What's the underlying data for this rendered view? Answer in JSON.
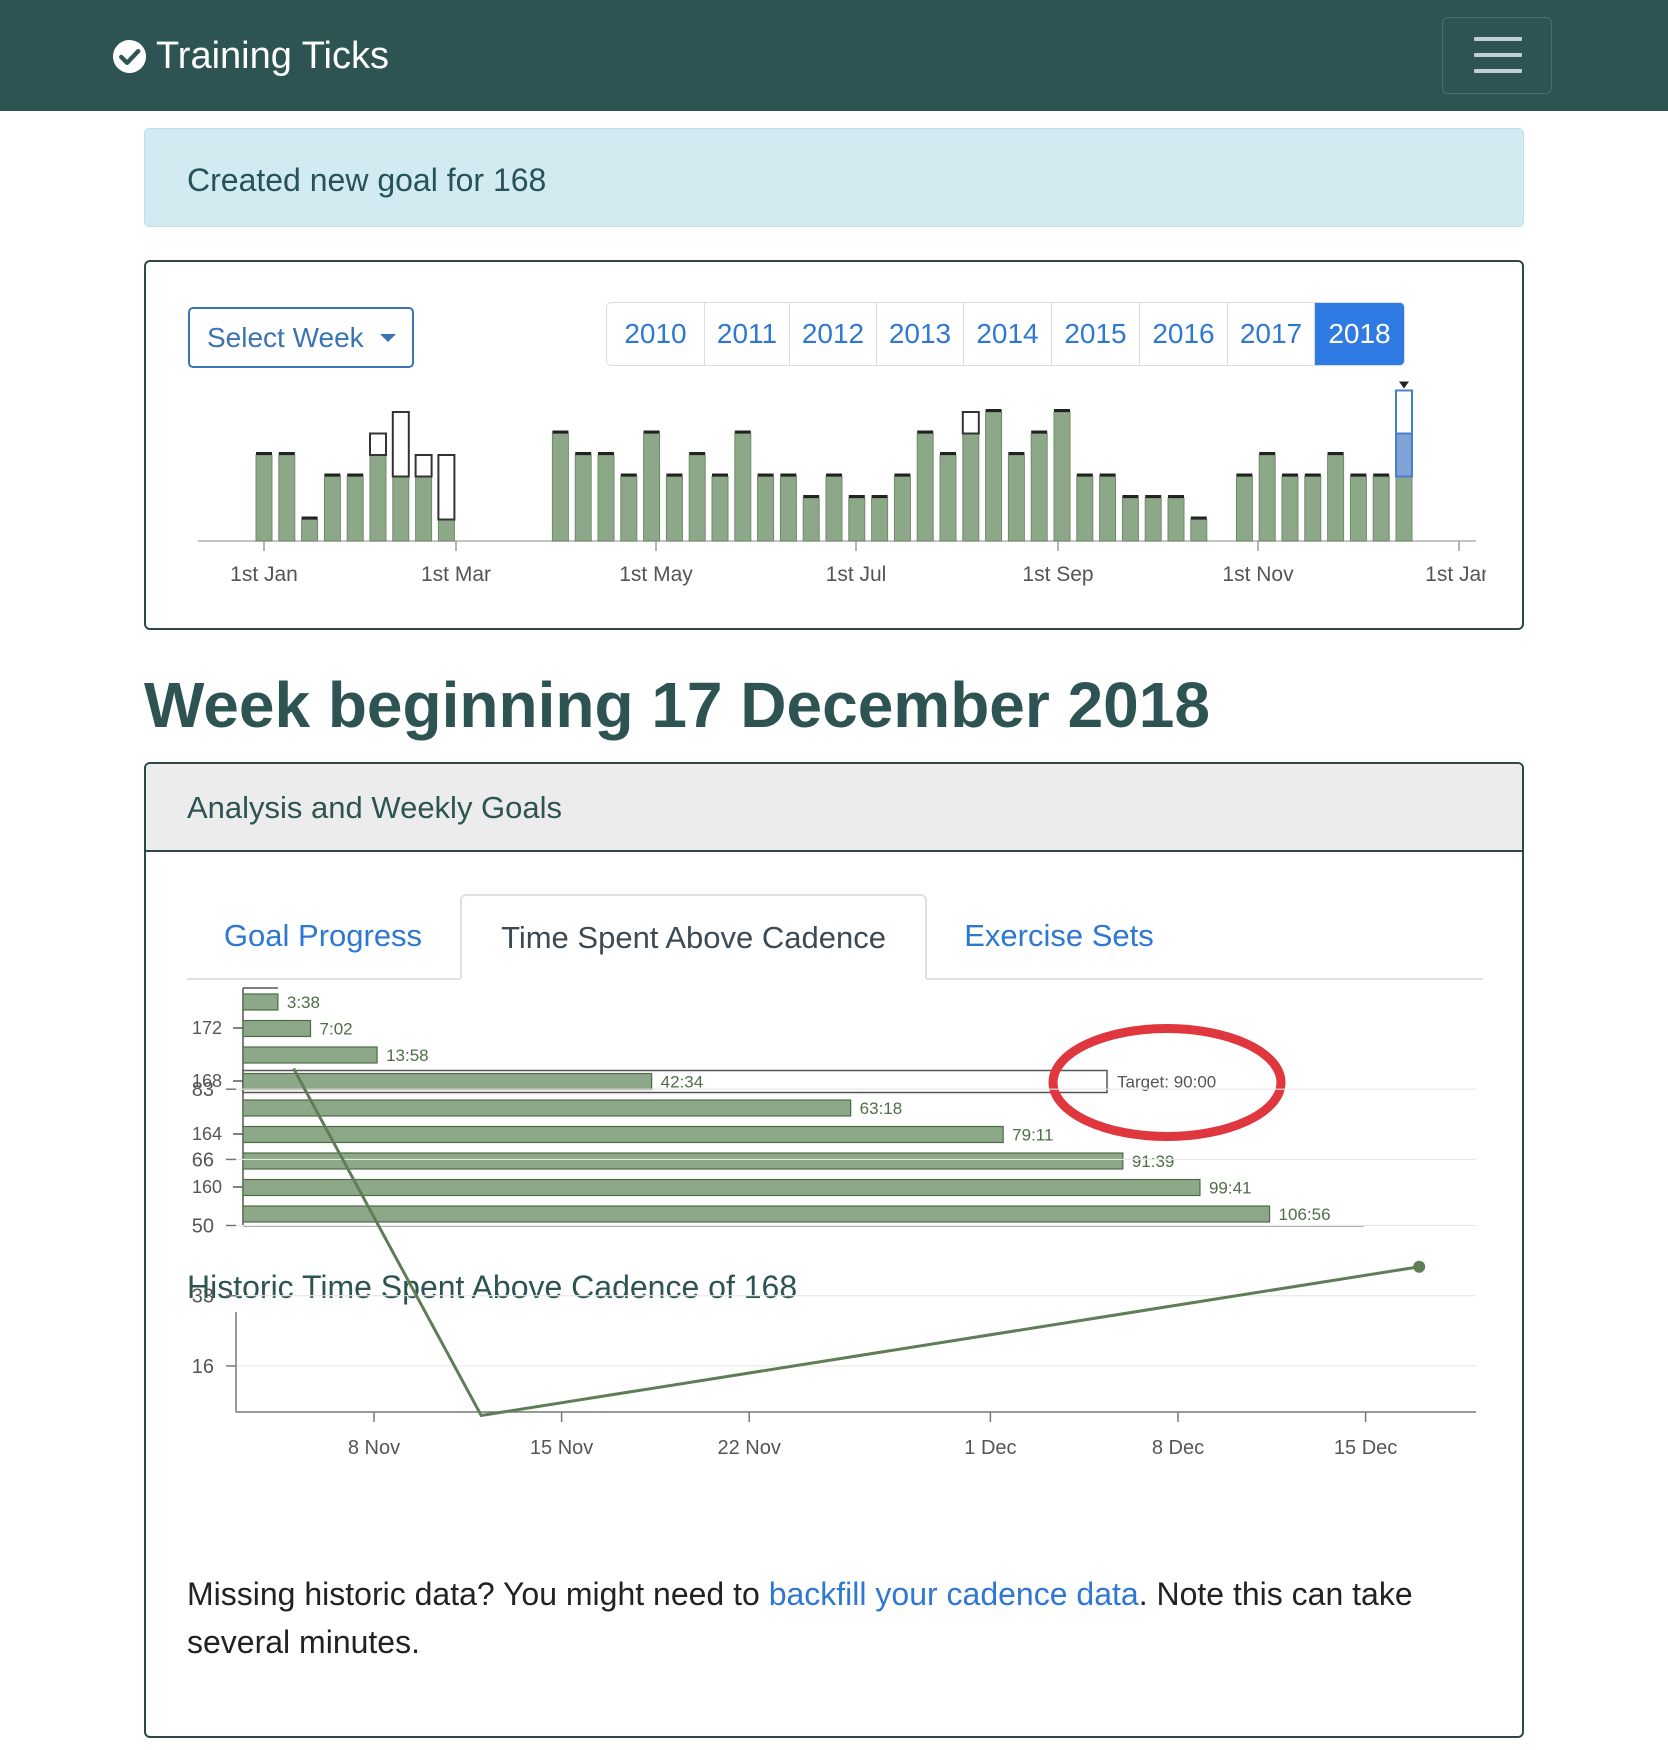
{
  "navbar": {
    "brand": "Training Ticks",
    "brand_icon": "check-circle-icon",
    "menu_icon": "hamburger-menu-icon"
  },
  "alert": {
    "text": "Created new goal for 168"
  },
  "week_selector": {
    "select_label": "Select Week",
    "years": [
      "2010",
      "2011",
      "2012",
      "2013",
      "2014",
      "2015",
      "2016",
      "2017",
      "2018"
    ],
    "active_year": "2018"
  },
  "page": {
    "title": "Week beginning 17 December 2018"
  },
  "analysis": {
    "header": "Analysis and Weekly Goals",
    "tabs": [
      {
        "label": "Goal Progress",
        "active": false
      },
      {
        "label": "Time Spent Above Cadence",
        "active": true
      },
      {
        "label": "Exercise Sets",
        "active": false
      }
    ],
    "historic_title": "Historic Time Spent Above Cadence of 168",
    "footnote": {
      "before": "Missing historic data? You might need to ",
      "link": "backfill your cadence data",
      "after": ". Note this can take several minutes."
    }
  },
  "colors": {
    "bar_green": "#8da888",
    "line_green": "#5f7d56",
    "nav_bg": "#2d5452",
    "accent_blue": "#2f7be3",
    "annotation_red": "#e0363e"
  },
  "chart_data": [
    {
      "type": "bar",
      "title": "",
      "x_tick_labels": [
        "1st Jan",
        "1st Mar",
        "1st May",
        "1st Jul",
        "1st Sep",
        "1st Nov",
        "1st Jan"
      ],
      "weeks": [
        {
          "week": 1,
          "done": 4,
          "goal_extra": 0
        },
        {
          "week": 2,
          "done": 4,
          "goal_extra": 0
        },
        {
          "week": 3,
          "done": 1,
          "goal_extra": 0
        },
        {
          "week": 4,
          "done": 3,
          "goal_extra": 0
        },
        {
          "week": 5,
          "done": 3,
          "goal_extra": 0
        },
        {
          "week": 6,
          "done": 4,
          "goal_extra": 1
        },
        {
          "week": 7,
          "done": 3,
          "goal_extra": 3
        },
        {
          "week": 8,
          "done": 3,
          "goal_extra": 1
        },
        {
          "week": 9,
          "done": 1,
          "goal_extra": 3
        },
        {
          "week": 14,
          "done": 5,
          "goal_extra": 0
        },
        {
          "week": 15,
          "done": 4,
          "goal_extra": 0
        },
        {
          "week": 16,
          "done": 4,
          "goal_extra": 0
        },
        {
          "week": 17,
          "done": 3,
          "goal_extra": 0
        },
        {
          "week": 18,
          "done": 5,
          "goal_extra": 0
        },
        {
          "week": 19,
          "done": 3,
          "goal_extra": 0
        },
        {
          "week": 20,
          "done": 4,
          "goal_extra": 0
        },
        {
          "week": 21,
          "done": 3,
          "goal_extra": 0
        },
        {
          "week": 22,
          "done": 5,
          "goal_extra": 0
        },
        {
          "week": 23,
          "done": 3,
          "goal_extra": 0
        },
        {
          "week": 24,
          "done": 3,
          "goal_extra": 0
        },
        {
          "week": 25,
          "done": 2,
          "goal_extra": 0
        },
        {
          "week": 26,
          "done": 3,
          "goal_extra": 0
        },
        {
          "week": 27,
          "done": 2,
          "goal_extra": 0
        },
        {
          "week": 28,
          "done": 2,
          "goal_extra": 0
        },
        {
          "week": 29,
          "done": 3,
          "goal_extra": 0
        },
        {
          "week": 30,
          "done": 5,
          "goal_extra": 0
        },
        {
          "week": 31,
          "done": 4,
          "goal_extra": 0
        },
        {
          "week": 32,
          "done": 5,
          "goal_extra": 1
        },
        {
          "week": 33,
          "done": 6,
          "goal_extra": 0
        },
        {
          "week": 34,
          "done": 4,
          "goal_extra": 0
        },
        {
          "week": 35,
          "done": 5,
          "goal_extra": 0
        },
        {
          "week": 36,
          "done": 6,
          "goal_extra": 0
        },
        {
          "week": 37,
          "done": 3,
          "goal_extra": 0
        },
        {
          "week": 38,
          "done": 3,
          "goal_extra": 0
        },
        {
          "week": 39,
          "done": 2,
          "goal_extra": 0
        },
        {
          "week": 40,
          "done": 2,
          "goal_extra": 0
        },
        {
          "week": 41,
          "done": 2,
          "goal_extra": 0
        },
        {
          "week": 42,
          "done": 1,
          "goal_extra": 0
        },
        {
          "week": 44,
          "done": 3,
          "goal_extra": 0
        },
        {
          "week": 45,
          "done": 4,
          "goal_extra": 0
        },
        {
          "week": 46,
          "done": 3,
          "goal_extra": 0
        },
        {
          "week": 47,
          "done": 3,
          "goal_extra": 0
        },
        {
          "week": 48,
          "done": 4,
          "goal_extra": 0
        },
        {
          "week": 49,
          "done": 3,
          "goal_extra": 0
        },
        {
          "week": 50,
          "done": 3,
          "goal_extra": 0
        },
        {
          "week": 51,
          "done": 3,
          "goal_extra": 4,
          "selected": true
        }
      ]
    },
    {
      "type": "bar",
      "orientation": "horizontal",
      "y_tick_labels": [
        "172",
        "168",
        "164",
        "160"
      ],
      "bars": [
        {
          "label": "3:38",
          "value": 3.633
        },
        {
          "label": "7:02",
          "value": 7.033
        },
        {
          "label": "13:58",
          "value": 13.967
        },
        {
          "label": "42:34",
          "value": 42.567,
          "cadence": 168,
          "target": 90.0,
          "target_label": "Target: 90:00"
        },
        {
          "label": "63:18",
          "value": 63.3
        },
        {
          "label": "79:11",
          "value": 79.183
        },
        {
          "label": "91:39",
          "value": 91.65
        },
        {
          "label": "99:41",
          "value": 99.683
        },
        {
          "label": "106:56",
          "value": 106.933
        }
      ],
      "annotation": "red circle around target label"
    },
    {
      "type": "line",
      "title": "Historic Time Spent Above Cadence of 168",
      "y_tick_labels": [
        "83",
        "66",
        "50",
        "33",
        "16"
      ],
      "x_tick_labels": [
        "8 Nov",
        "15 Nov",
        "22 Nov",
        "1 Dec",
        "8 Dec",
        "15 Dec"
      ],
      "points": [
        {
          "x": "2018-11-05",
          "y": 88
        },
        {
          "x": "2018-11-12",
          "y": 4
        },
        {
          "x": "2018-12-17",
          "y": 40
        }
      ]
    }
  ]
}
